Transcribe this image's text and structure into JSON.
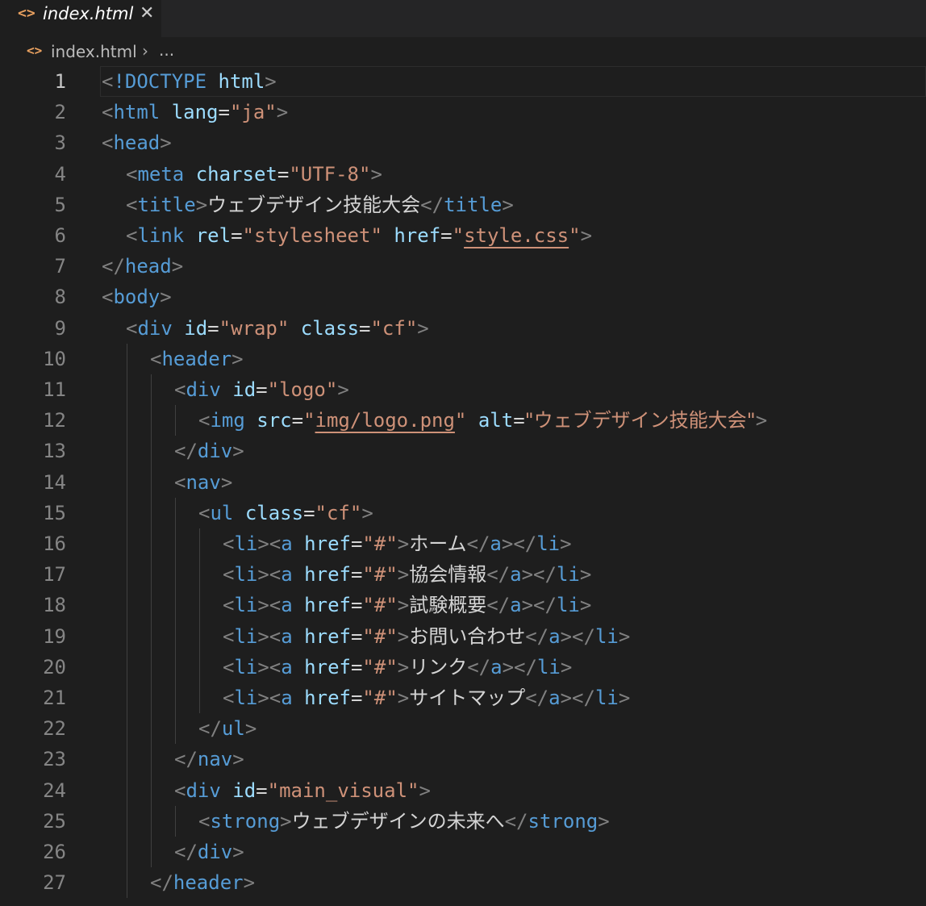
{
  "tab": {
    "icon": "html-file-icon",
    "title": "index.html",
    "close": "✕"
  },
  "breadcrumb": {
    "icon": "html-file-icon",
    "file": "index.html",
    "sep": "›",
    "more": "..."
  },
  "lines": [
    {
      "n": "1",
      "indent": 0,
      "tokens": [
        [
          "p",
          "<"
        ],
        [
          "t",
          "!DOCTYPE"
        ],
        [
          "e",
          " "
        ],
        [
          "a",
          "html"
        ],
        [
          "p",
          ">"
        ]
      ]
    },
    {
      "n": "2",
      "indent": 0,
      "tokens": [
        [
          "p",
          "<"
        ],
        [
          "t",
          "html"
        ],
        [
          "e",
          " "
        ],
        [
          "a",
          "lang"
        ],
        [
          "e",
          "="
        ],
        [
          "s",
          "\"ja\""
        ],
        [
          "p",
          ">"
        ]
      ]
    },
    {
      "n": "3",
      "indent": 0,
      "tokens": [
        [
          "p",
          "<"
        ],
        [
          "t",
          "head"
        ],
        [
          "p",
          ">"
        ]
      ]
    },
    {
      "n": "4",
      "indent": 1,
      "tokens": [
        [
          "p",
          "<"
        ],
        [
          "t",
          "meta"
        ],
        [
          "e",
          " "
        ],
        [
          "a",
          "charset"
        ],
        [
          "e",
          "="
        ],
        [
          "s",
          "\"UTF-8\""
        ],
        [
          "p",
          ">"
        ]
      ]
    },
    {
      "n": "5",
      "indent": 1,
      "tokens": [
        [
          "p",
          "<"
        ],
        [
          "t",
          "title"
        ],
        [
          "p",
          ">"
        ],
        [
          "e",
          "ウェブデザイン技能大会"
        ],
        [
          "p",
          "</"
        ],
        [
          "t",
          "title"
        ],
        [
          "p",
          ">"
        ]
      ]
    },
    {
      "n": "6",
      "indent": 1,
      "tokens": [
        [
          "p",
          "<"
        ],
        [
          "t",
          "link"
        ],
        [
          "e",
          " "
        ],
        [
          "a",
          "rel"
        ],
        [
          "e",
          "="
        ],
        [
          "s",
          "\"stylesheet\""
        ],
        [
          "e",
          " "
        ],
        [
          "a",
          "href"
        ],
        [
          "e",
          "="
        ],
        [
          "s",
          "\""
        ],
        [
          "su",
          "style.css"
        ],
        [
          "s",
          "\""
        ],
        [
          "p",
          ">"
        ]
      ]
    },
    {
      "n": "7",
      "indent": 0,
      "tokens": [
        [
          "p",
          "</"
        ],
        [
          "t",
          "head"
        ],
        [
          "p",
          ">"
        ]
      ]
    },
    {
      "n": "8",
      "indent": 0,
      "tokens": [
        [
          "p",
          "<"
        ],
        [
          "t",
          "body"
        ],
        [
          "p",
          ">"
        ]
      ]
    },
    {
      "n": "9",
      "indent": 1,
      "tokens": [
        [
          "p",
          "<"
        ],
        [
          "t",
          "div"
        ],
        [
          "e",
          " "
        ],
        [
          "a",
          "id"
        ],
        [
          "e",
          "="
        ],
        [
          "s",
          "\"wrap\""
        ],
        [
          "e",
          " "
        ],
        [
          "a",
          "class"
        ],
        [
          "e",
          "="
        ],
        [
          "s",
          "\"cf\""
        ],
        [
          "p",
          ">"
        ]
      ]
    },
    {
      "n": "10",
      "indent": 2,
      "tokens": [
        [
          "p",
          "<"
        ],
        [
          "t",
          "header"
        ],
        [
          "p",
          ">"
        ]
      ]
    },
    {
      "n": "11",
      "indent": 3,
      "tokens": [
        [
          "p",
          "<"
        ],
        [
          "t",
          "div"
        ],
        [
          "e",
          " "
        ],
        [
          "a",
          "id"
        ],
        [
          "e",
          "="
        ],
        [
          "s",
          "\"logo\""
        ],
        [
          "p",
          ">"
        ]
      ]
    },
    {
      "n": "12",
      "indent": 4,
      "tokens": [
        [
          "p",
          "<"
        ],
        [
          "t",
          "img"
        ],
        [
          "e",
          " "
        ],
        [
          "a",
          "src"
        ],
        [
          "e",
          "="
        ],
        [
          "s",
          "\""
        ],
        [
          "su",
          "img/logo.png"
        ],
        [
          "s",
          "\""
        ],
        [
          "e",
          " "
        ],
        [
          "a",
          "alt"
        ],
        [
          "e",
          "="
        ],
        [
          "s",
          "\"ウェブデザイン技能大会\""
        ],
        [
          "p",
          ">"
        ]
      ]
    },
    {
      "n": "13",
      "indent": 3,
      "tokens": [
        [
          "p",
          "</"
        ],
        [
          "t",
          "div"
        ],
        [
          "p",
          ">"
        ]
      ]
    },
    {
      "n": "14",
      "indent": 3,
      "tokens": [
        [
          "p",
          "<"
        ],
        [
          "t",
          "nav"
        ],
        [
          "p",
          ">"
        ]
      ]
    },
    {
      "n": "15",
      "indent": 4,
      "tokens": [
        [
          "p",
          "<"
        ],
        [
          "t",
          "ul"
        ],
        [
          "e",
          " "
        ],
        [
          "a",
          "class"
        ],
        [
          "e",
          "="
        ],
        [
          "s",
          "\"cf\""
        ],
        [
          "p",
          ">"
        ]
      ]
    },
    {
      "n": "16",
      "indent": 5,
      "tokens": [
        [
          "p",
          "<"
        ],
        [
          "t",
          "li"
        ],
        [
          "p",
          "><"
        ],
        [
          "t",
          "a"
        ],
        [
          "e",
          " "
        ],
        [
          "a",
          "href"
        ],
        [
          "e",
          "="
        ],
        [
          "s",
          "\"#\""
        ],
        [
          "p",
          ">"
        ],
        [
          "e",
          "ホーム"
        ],
        [
          "p",
          "</"
        ],
        [
          "t",
          "a"
        ],
        [
          "p",
          "></"
        ],
        [
          "t",
          "li"
        ],
        [
          "p",
          ">"
        ]
      ]
    },
    {
      "n": "17",
      "indent": 5,
      "tokens": [
        [
          "p",
          "<"
        ],
        [
          "t",
          "li"
        ],
        [
          "p",
          "><"
        ],
        [
          "t",
          "a"
        ],
        [
          "e",
          " "
        ],
        [
          "a",
          "href"
        ],
        [
          "e",
          "="
        ],
        [
          "s",
          "\"#\""
        ],
        [
          "p",
          ">"
        ],
        [
          "e",
          "協会情報"
        ],
        [
          "p",
          "</"
        ],
        [
          "t",
          "a"
        ],
        [
          "p",
          "></"
        ],
        [
          "t",
          "li"
        ],
        [
          "p",
          ">"
        ]
      ]
    },
    {
      "n": "18",
      "indent": 5,
      "tokens": [
        [
          "p",
          "<"
        ],
        [
          "t",
          "li"
        ],
        [
          "p",
          "><"
        ],
        [
          "t",
          "a"
        ],
        [
          "e",
          " "
        ],
        [
          "a",
          "href"
        ],
        [
          "e",
          "="
        ],
        [
          "s",
          "\"#\""
        ],
        [
          "p",
          ">"
        ],
        [
          "e",
          "試験概要"
        ],
        [
          "p",
          "</"
        ],
        [
          "t",
          "a"
        ],
        [
          "p",
          "></"
        ],
        [
          "t",
          "li"
        ],
        [
          "p",
          ">"
        ]
      ]
    },
    {
      "n": "19",
      "indent": 5,
      "tokens": [
        [
          "p",
          "<"
        ],
        [
          "t",
          "li"
        ],
        [
          "p",
          "><"
        ],
        [
          "t",
          "a"
        ],
        [
          "e",
          " "
        ],
        [
          "a",
          "href"
        ],
        [
          "e",
          "="
        ],
        [
          "s",
          "\"#\""
        ],
        [
          "p",
          ">"
        ],
        [
          "e",
          "お問い合わせ"
        ],
        [
          "p",
          "</"
        ],
        [
          "t",
          "a"
        ],
        [
          "p",
          "></"
        ],
        [
          "t",
          "li"
        ],
        [
          "p",
          ">"
        ]
      ]
    },
    {
      "n": "20",
      "indent": 5,
      "tokens": [
        [
          "p",
          "<"
        ],
        [
          "t",
          "li"
        ],
        [
          "p",
          "><"
        ],
        [
          "t",
          "a"
        ],
        [
          "e",
          " "
        ],
        [
          "a",
          "href"
        ],
        [
          "e",
          "="
        ],
        [
          "s",
          "\"#\""
        ],
        [
          "p",
          ">"
        ],
        [
          "e",
          "リンク"
        ],
        [
          "p",
          "</"
        ],
        [
          "t",
          "a"
        ],
        [
          "p",
          "></"
        ],
        [
          "t",
          "li"
        ],
        [
          "p",
          ">"
        ]
      ]
    },
    {
      "n": "21",
      "indent": 5,
      "tokens": [
        [
          "p",
          "<"
        ],
        [
          "t",
          "li"
        ],
        [
          "p",
          "><"
        ],
        [
          "t",
          "a"
        ],
        [
          "e",
          " "
        ],
        [
          "a",
          "href"
        ],
        [
          "e",
          "="
        ],
        [
          "s",
          "\"#\""
        ],
        [
          "p",
          ">"
        ],
        [
          "e",
          "サイトマップ"
        ],
        [
          "p",
          "</"
        ],
        [
          "t",
          "a"
        ],
        [
          "p",
          "></"
        ],
        [
          "t",
          "li"
        ],
        [
          "p",
          ">"
        ]
      ]
    },
    {
      "n": "22",
      "indent": 4,
      "tokens": [
        [
          "p",
          "</"
        ],
        [
          "t",
          "ul"
        ],
        [
          "p",
          ">"
        ]
      ]
    },
    {
      "n": "23",
      "indent": 3,
      "tokens": [
        [
          "p",
          "</"
        ],
        [
          "t",
          "nav"
        ],
        [
          "p",
          ">"
        ]
      ]
    },
    {
      "n": "24",
      "indent": 3,
      "tokens": [
        [
          "p",
          "<"
        ],
        [
          "t",
          "div"
        ],
        [
          "e",
          " "
        ],
        [
          "a",
          "id"
        ],
        [
          "e",
          "="
        ],
        [
          "s",
          "\"main_visual\""
        ],
        [
          "p",
          ">"
        ]
      ]
    },
    {
      "n": "25",
      "indent": 4,
      "tokens": [
        [
          "p",
          "<"
        ],
        [
          "t",
          "strong"
        ],
        [
          "p",
          ">"
        ],
        [
          "e",
          "ウェブデザインの未来へ"
        ],
        [
          "p",
          "</"
        ],
        [
          "t",
          "strong"
        ],
        [
          "p",
          ">"
        ]
      ]
    },
    {
      "n": "26",
      "indent": 3,
      "tokens": [
        [
          "p",
          "</"
        ],
        [
          "t",
          "div"
        ],
        [
          "p",
          ">"
        ]
      ]
    },
    {
      "n": "27",
      "indent": 2,
      "tokens": [
        [
          "p",
          "</"
        ],
        [
          "t",
          "header"
        ],
        [
          "p",
          ">"
        ]
      ]
    }
  ],
  "colors": {
    "background": "#1e1e1e",
    "tag": "#569cd6",
    "attribute": "#9cdcfe",
    "string": "#ce9178",
    "punctuation": "#808080"
  }
}
